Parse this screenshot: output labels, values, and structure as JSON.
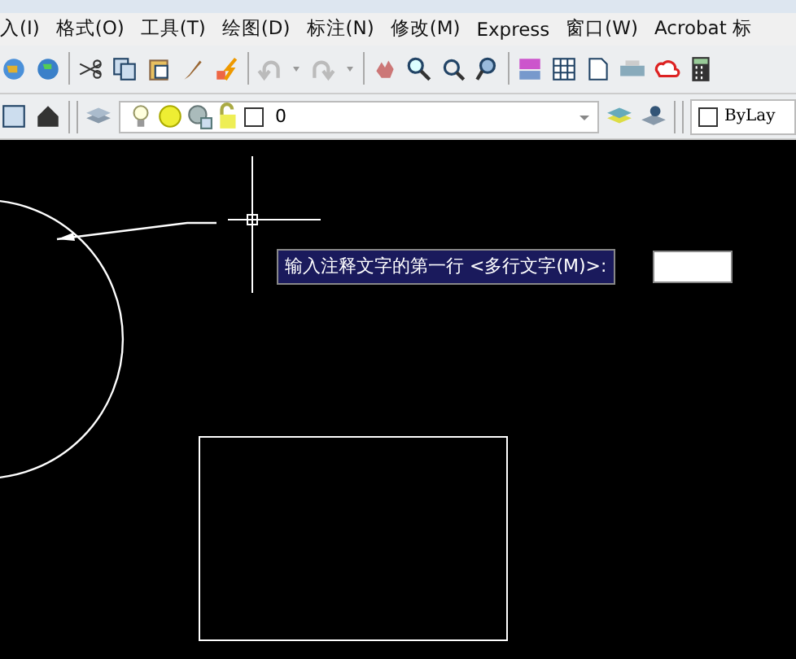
{
  "menu_bar": {
    "items": [
      "入(I)",
      "格式(O)",
      "工具(T)",
      "绘图(D)",
      "标注(N)",
      "修改(M)",
      "Express",
      "窗口(W)",
      "Acrobat 标"
    ]
  },
  "standard_toolbar": {
    "undo": {
      "disabled": true
    },
    "redo": {
      "disabled": true
    }
  },
  "layers_toolbar": {
    "layer_value": "0"
  },
  "properties_toolbar": {
    "color_value": "ByLay"
  },
  "drawing_area": {
    "prompt": "输入注释文字的第一行 <多行文字(M)>:"
  }
}
